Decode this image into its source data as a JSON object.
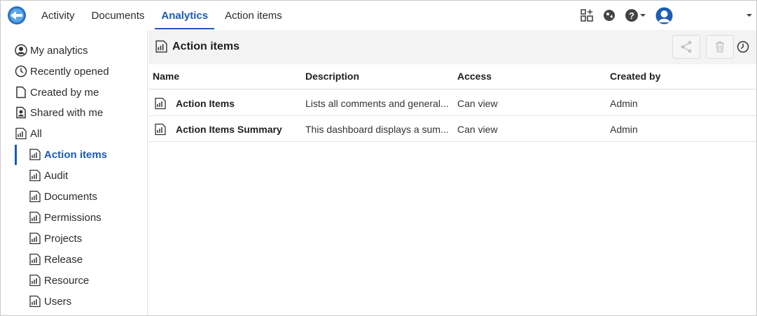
{
  "nav": {
    "tabs": [
      {
        "label": "Activity",
        "active": false
      },
      {
        "label": "Documents",
        "active": false
      },
      {
        "label": "Analytics",
        "active": true
      },
      {
        "label": "Action items",
        "active": false
      }
    ],
    "icons": [
      "app-store-icon",
      "learning-center-icon",
      "help-icon",
      "user-avatar-icon",
      "chevron-down-icon"
    ]
  },
  "sidebar": {
    "items": [
      {
        "label": "My analytics",
        "icon": "user-circle-icon"
      },
      {
        "label": "Recently opened",
        "icon": "clock-icon"
      },
      {
        "label": "Created by me",
        "icon": "document-icon"
      },
      {
        "label": "Shared with me",
        "icon": "shared-user-icon"
      },
      {
        "label": "All",
        "icon": "analytics-report-icon"
      },
      {
        "label": "Action items",
        "icon": "analytics-report-icon",
        "active": true
      },
      {
        "label": "Audit",
        "icon": "analytics-report-icon"
      },
      {
        "label": "Documents",
        "icon": "analytics-report-icon"
      },
      {
        "label": "Permissions",
        "icon": "analytics-report-icon"
      },
      {
        "label": "Projects",
        "icon": "analytics-report-icon"
      },
      {
        "label": "Release",
        "icon": "analytics-report-icon"
      },
      {
        "label": "Resource",
        "icon": "analytics-report-icon"
      },
      {
        "label": "Users",
        "icon": "analytics-report-icon"
      }
    ]
  },
  "main": {
    "title": "Action items",
    "actions": {
      "share_icon": "share-icon",
      "delete_icon": "trash-icon",
      "history_icon": "history-icon"
    },
    "table": {
      "headers": [
        "Name",
        "Description",
        "Access",
        "Created by"
      ],
      "rows": [
        {
          "name": "Action Items",
          "description": "Lists all comments and general...",
          "access": "Can view",
          "created_by": "Admin"
        },
        {
          "name": "Action Items Summary",
          "description": "This dashboard displays a sum...",
          "access": "Can view",
          "created_by": "Admin"
        }
      ]
    }
  },
  "colors": {
    "accent": "#1d5bb5",
    "header_bg": "#f3f3f3",
    "border": "#dcdcdc"
  }
}
